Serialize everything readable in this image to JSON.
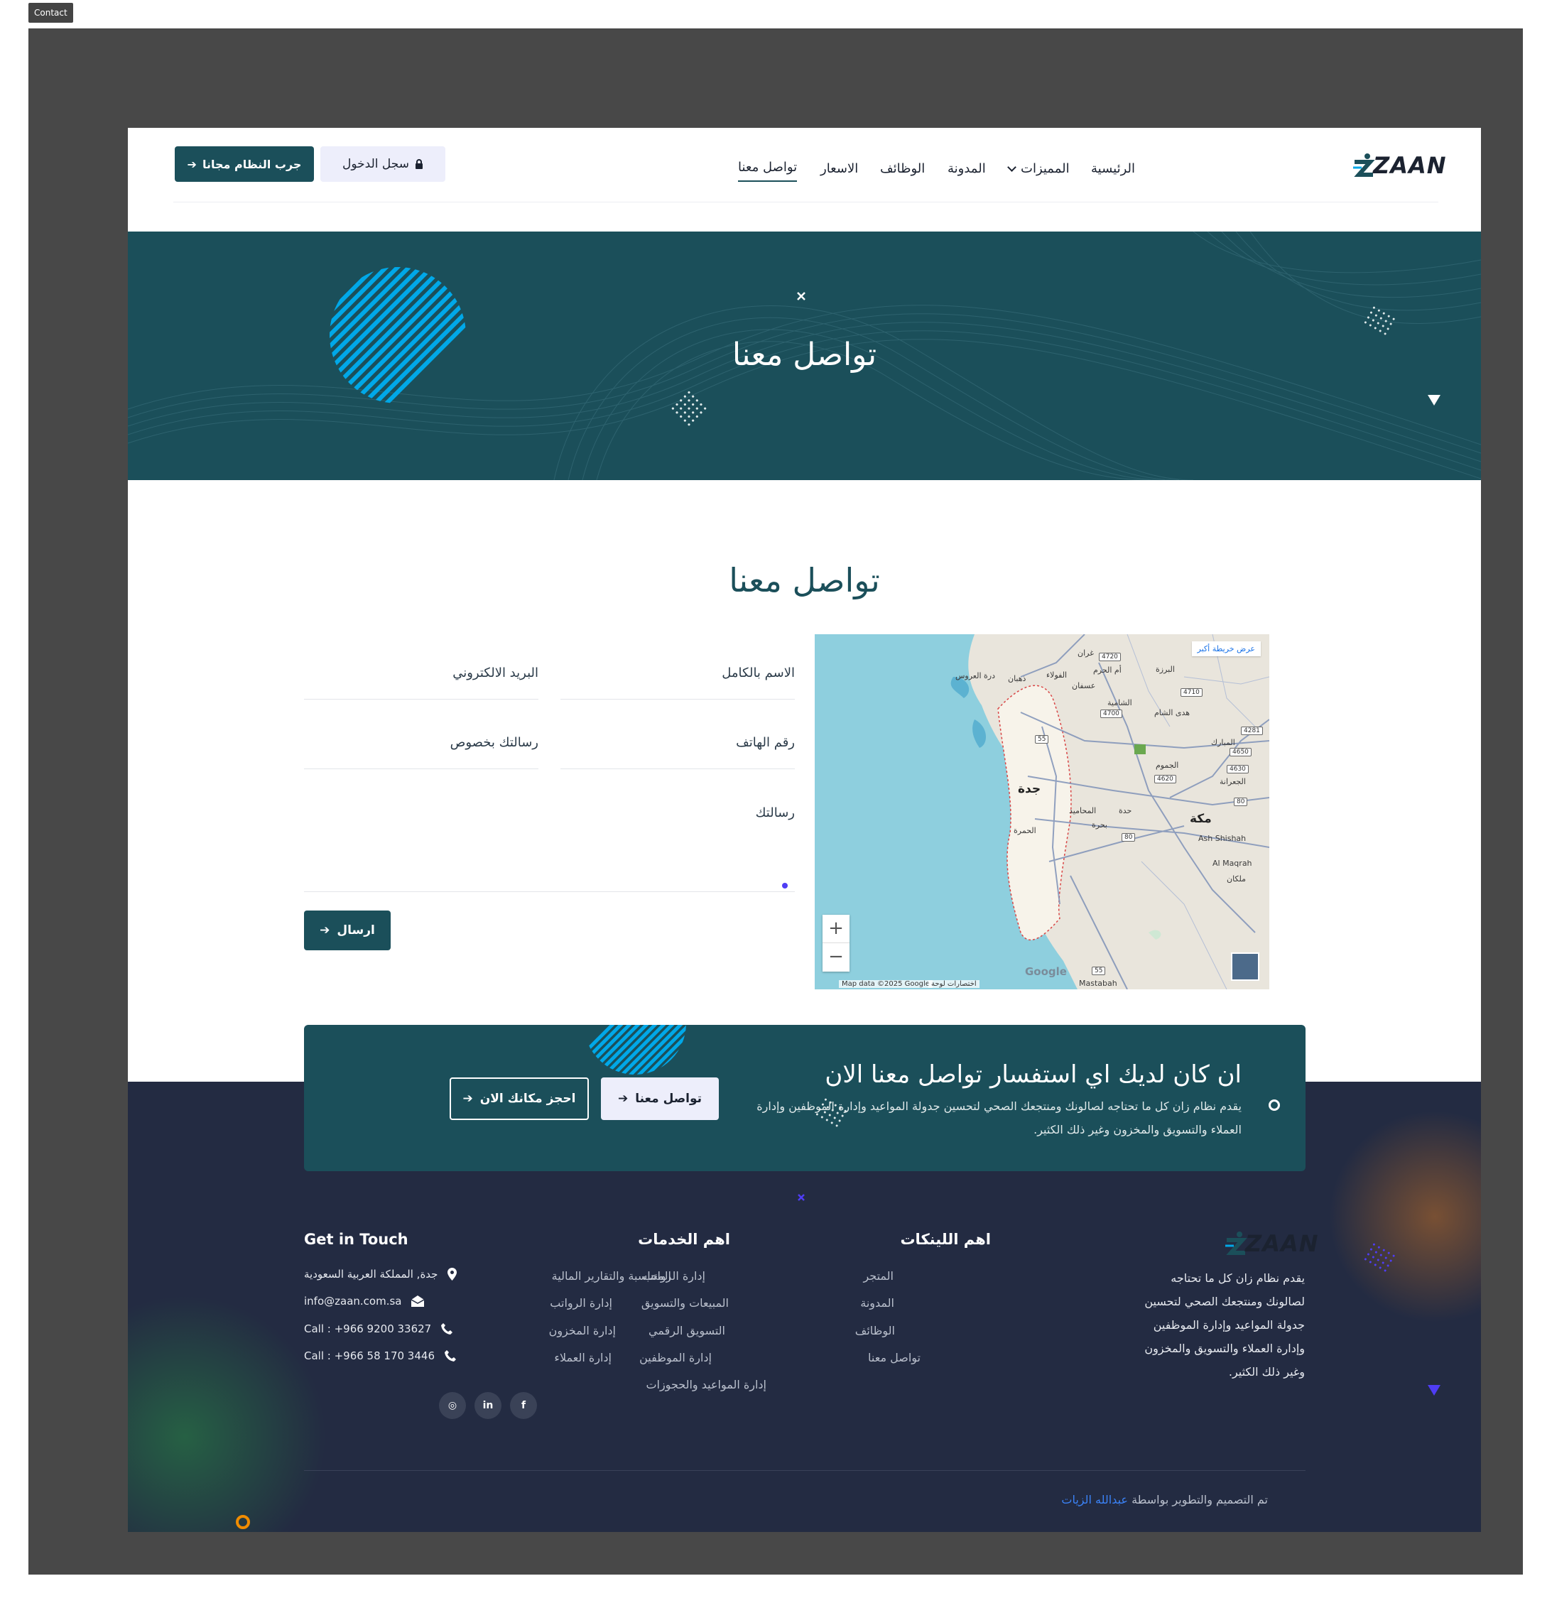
{
  "tab_label": "Contact",
  "brand": {
    "name": "ZAAN",
    "primary": "#1b4f5a",
    "dark": "#232b42",
    "accent": "#00a8e8"
  },
  "nav": {
    "items": [
      {
        "label": "الرئيسية"
      },
      {
        "label": "المميزات"
      },
      {
        "label": "المدونة"
      },
      {
        "label": "الوظائف"
      },
      {
        "label": "الاسعار"
      },
      {
        "label": "تواصل معنا"
      }
    ],
    "active": "تواصل معنا",
    "login_label": "سجل الدخول",
    "try_label": "جرب النظام مجانا"
  },
  "hero": {
    "title": "تواصل معنا"
  },
  "contact": {
    "title": "تواصل معنا",
    "form": {
      "name_placeholder": "الاسم بالكامل",
      "email_placeholder": "البريد الالكتروني",
      "phone_placeholder": "رقم الهاتف",
      "subject_placeholder": "رسالتك بخصوص",
      "message_placeholder": "رسالتك",
      "submit_label": "ارسال"
    },
    "map": {
      "larger_map_label": "عرض خريطة أكبر",
      "copyright": "Map data ©2025 Google",
      "shortcuts": "اختصارات لوحة",
      "google_logo": "Google",
      "zoom_in": "+",
      "zoom_out": "−",
      "places": {
        "jeddah": "جدة",
        "makkah": "مكة",
        "ash_shishah": "Ash Shishah",
        "al_maqrah": "Al Maqrah",
        "mastabah": "Mastabah",
        "milkan": "ملكان",
        "usfan": "عسفان",
        "huda_alsham": "هدى الشام",
        "al_mubarak": "المبارك",
        "al_jumum": "الجموم",
        "al_jiranah": "الجعرانة",
        "bahrah": "بحرة",
        "al_hamra": "الحمرة",
        "ghoran": "غران",
        "al_barza": "البرزة",
        "um_alharam": "أم الحرم",
        "al_shamiya": "الشامية",
        "durrat_alarus": "درة العروس",
        "dhahban": "ذهبان",
        "al_fawla": "الفولاء",
        "al_mahamid": "المحاميد",
        "hadda": "حدة"
      },
      "shields": [
        "4720",
        "4710",
        "4700",
        "4281",
        "4650",
        "4630",
        "4620",
        "80",
        "55",
        "80",
        "55"
      ]
    }
  },
  "cta": {
    "title": "ان كان لديك اي استفسار تواصل معنا الان",
    "text": "يقدم نظام زان كل ما تحتاجه لصالونك ومنتجعك الصحي لتحسين جدولة المواعيد وإدارة الموظفين وإدارة العملاء والتسويق والمخزون وغير ذلك الكثير.",
    "contact_label": "تواصل معنا",
    "book_label": "احجز مكانك الان"
  },
  "footer": {
    "about": "يقدم نظام زان كل ما تحتاجه لصالونك ومنتجعك الصحي لتحسين جدولة المواعيد وإدارة الموظفين وإدارة العملاء والتسويق والمخزون وغير ذلك الكثير.",
    "links_title": "اهم اللينكات",
    "links": [
      "المتجر",
      "المدونة",
      "الوظائف",
      "تواصل معنا"
    ],
    "services_title": "اهم الخدمات",
    "services_col1": [
      "إدارة الرواتب",
      "المبيعات والتسويق",
      "التسويق الرقمي",
      "إدارة الموظفين",
      "إدارة المواعيد والحجوزات"
    ],
    "services_col2": [
      "المحاسبة والتقارير المالية",
      "إدارة الرواتب",
      "إدارة المخزون",
      "إدارة العملاء"
    ],
    "touch_title": "Get in Touch",
    "address": "جدة, المملكة العربية السعودية",
    "email": "info@zaan.com.sa",
    "phone1": "Call : +966 9200 33627",
    "phone2": "Call : +966 58 170 3446",
    "social": [
      "facebook",
      "linkedin",
      "instagram"
    ],
    "social_labels": {
      "facebook": "f",
      "linkedin": "in",
      "instagram": "◎"
    },
    "credit_text": "تم التصميم والتطوير بواسطة",
    "credit_name": "عبدالله الزيات"
  }
}
